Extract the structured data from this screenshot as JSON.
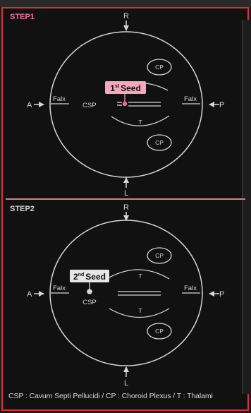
{
  "steps": [
    {
      "label": "STEP1",
      "seed_number": "1",
      "seed_suffix": "st",
      "seed_word": "Seed"
    },
    {
      "label": "STEP2",
      "seed_number": "2",
      "seed_suffix": "nd",
      "seed_word": "Seed"
    }
  ],
  "labels": {
    "right": "R",
    "left": "L",
    "anterior": "A",
    "posterior": "P",
    "falx": "Falx",
    "csp": "CSP",
    "cp": "CP",
    "thalami": "T"
  },
  "legend": "CSP : Cavum Septi Pellucidi / CP : Choroid Plexus / T : Thalami",
  "colors": {
    "frame": "#d8323a",
    "step1_label": "#f06e9a",
    "seed1_box": "#f4a8c0",
    "seed2_box": "#e6e6e6",
    "line": "#d6d6d6"
  }
}
